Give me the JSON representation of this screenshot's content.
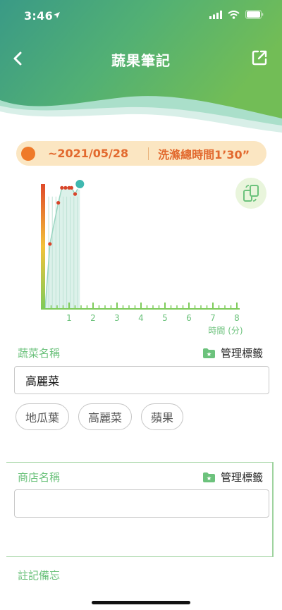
{
  "status_bar": {
    "time": "3:46"
  },
  "nav": {
    "title": "蔬果筆記"
  },
  "info": {
    "date": "~2021/05/28",
    "duration": "洗滌總時間1’30”"
  },
  "colors": {
    "brand_green": "#6cc27c",
    "accent_orange": "#e2692e"
  },
  "chart_data": {
    "type": "area",
    "xlabel": "時間 (分)",
    "xlim": [
      0,
      8
    ],
    "x_ticks": [
      "1",
      "2",
      "3",
      "4",
      "5",
      "6",
      "7",
      "8"
    ],
    "ylim": [
      0,
      1
    ],
    "series": [
      {
        "x": [
          0.0,
          0.2,
          0.55,
          0.7,
          0.85,
          1.0,
          1.1,
          1.25,
          1.45
        ],
        "y": [
          0.0,
          0.52,
          0.85,
          0.97,
          0.97,
          0.97,
          0.97,
          0.92,
          1.0
        ]
      }
    ]
  },
  "vegetable": {
    "label": "蔬菜名稱",
    "manage_label": "管理標籤",
    "value": "高麗菜",
    "chips": [
      "地瓜葉",
      "高麗菜",
      "蘋果"
    ]
  },
  "store": {
    "label": "商店名稱",
    "manage_label": "管理標籤",
    "value": ""
  },
  "notes": {
    "label": "註記備忘"
  }
}
